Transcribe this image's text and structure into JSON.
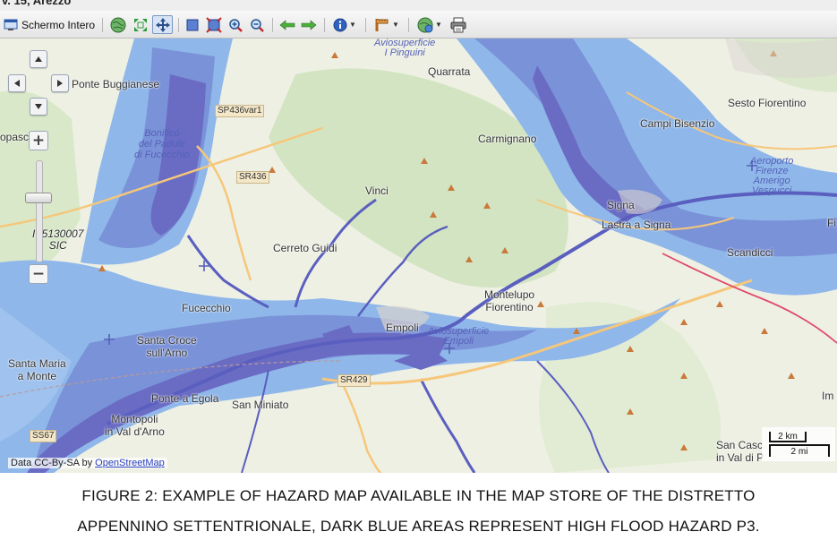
{
  "window": {
    "title_fragment": "v. 15, Arezzo"
  },
  "toolbar": {
    "fullscreen_label": "Schermo Intero",
    "colors": {
      "accent": "#7a96c2",
      "active_bg": "#d7e4f6"
    }
  },
  "map": {
    "colors": {
      "land": "#eef0e4",
      "hazard_light": "#8fb7ea",
      "hazard_medium": "#7a92d8",
      "hazard_high": "#6a6cc4",
      "river": "#5a5fbf",
      "road": "#f6c77a",
      "rail": "#e04a6a",
      "forest": "#d5e6c6"
    },
    "places": {
      "aviosuperficie_pinguini": "Aviosuperficie\nI Pinguini",
      "quarrata": "Quarrata",
      "ponte_buggianese": "Ponte Buggianese",
      "sesto_fiorentino": "Sesto Fiorentino",
      "campi_bisenzio": "Campi Bisenzio",
      "sp436var1": "SP436var1",
      "carmignano": "Carmignano",
      "bonifico": "Bonifico\ndel Padule\ndi Fucecchio",
      "aeroporto": "Aeroporto\nFirenze\nAmerigo\nVespucci",
      "sr436": "SR436",
      "vinci": "Vinci",
      "signa": "Signa",
      "lastra_a_signa": "Lastra a Signa",
      "sic": "IT5130007\nSIC",
      "cerreto_guidi": "Cerreto Guidi",
      "scandicci": "Scandicci",
      "montelupo": "Montelupo\nFiorentino",
      "fucecchio": "Fucecchio",
      "empoli": "Empoli",
      "aviosuperficie_empoli": "Aviosuperficie\nEmpoli",
      "santa_croce": "Santa Croce\nsull'Arno",
      "santa_maria": "Santa Maria\na Monte",
      "sr429": "SR429",
      "ponte_a_egola": "Ponte a Egola",
      "san_miniato": "San Miniato",
      "montopoli": "Montopoli\nin Val d'Arno",
      "ss67": "SS67",
      "san_casciano": "San Casc\nin Val di P",
      "fi": "Fi",
      "im": "Im",
      "opasc": "opasc"
    },
    "attribution": {
      "text": "Data CC-By-SA by ",
      "link": "OpenStreetMap"
    },
    "scale": {
      "km": "2 km",
      "mi": "2 mi"
    }
  },
  "caption": {
    "line1": "FIGURE 2: EXAMPLE OF HAZARD MAP AVAILABLE IN THE MAP STORE OF THE DISTRETTO",
    "line2": "APPENNINO SETTENTRIONALE, DARK BLUE AREAS REPRESENT HIGH FLOOD HAZARD P3."
  }
}
